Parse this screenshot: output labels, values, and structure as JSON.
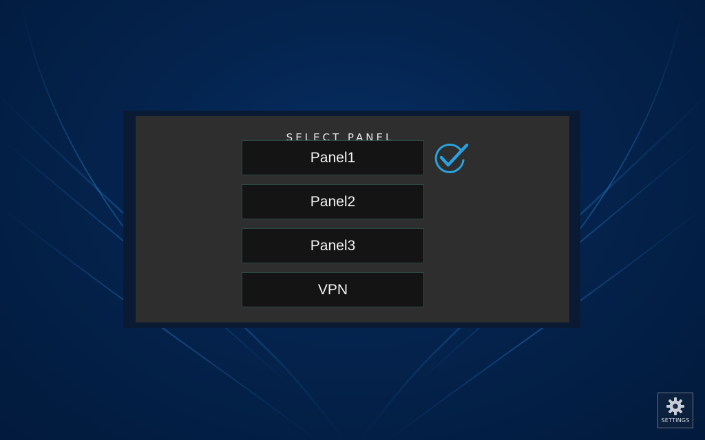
{
  "dialog": {
    "title": "SELECT PANEL",
    "options": [
      {
        "label": "Panel1",
        "selected": true
      },
      {
        "label": "Panel2",
        "selected": false
      },
      {
        "label": "Panel3",
        "selected": false
      },
      {
        "label": "VPN",
        "selected": false
      }
    ],
    "selected_icon": "checkmark-circle-icon"
  },
  "settings": {
    "label": "SETTINGS",
    "icon": "gear-icon"
  },
  "colors": {
    "accent": "#29a3e0",
    "panel_bg": "#2e2e2e",
    "option_bg": "#141414",
    "background": "#04234d"
  }
}
